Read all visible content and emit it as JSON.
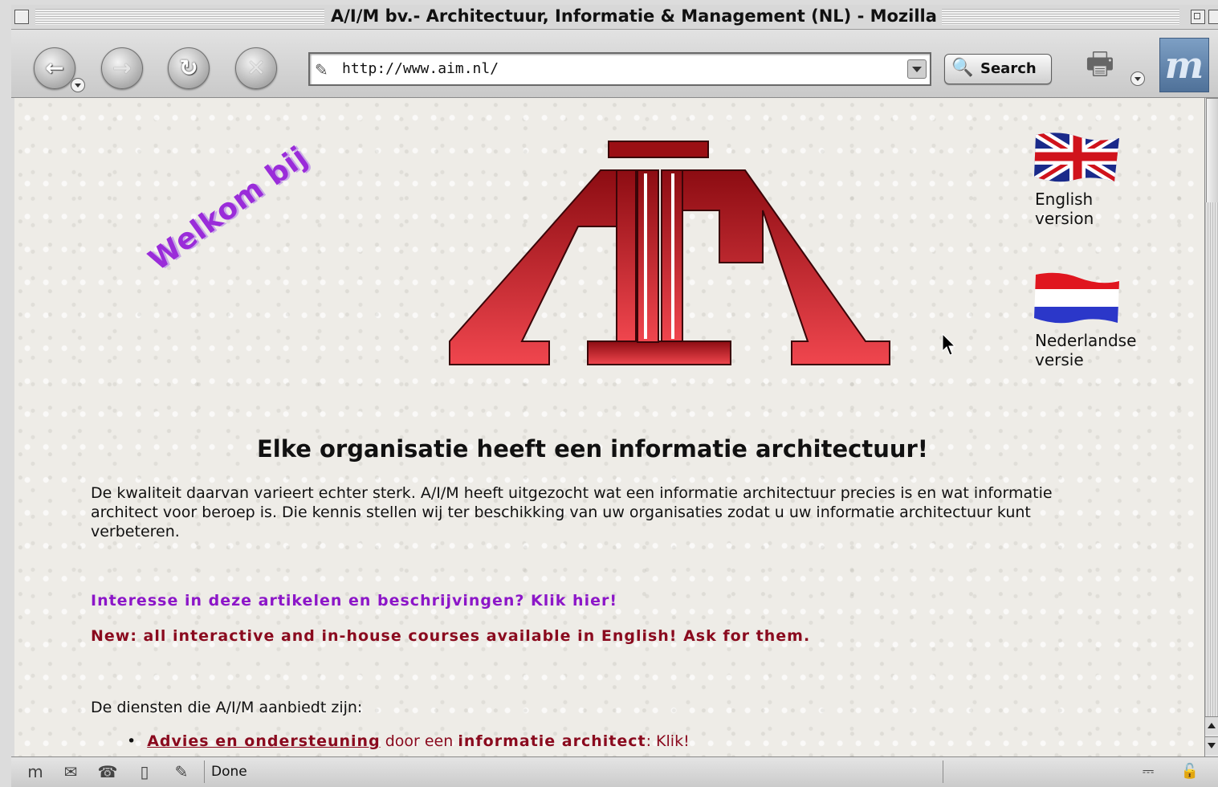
{
  "window": {
    "title": "A/I/M bv.- Architectuur, Informatie & Management (NL) - Mozilla"
  },
  "toolbar": {
    "back_icon": "←",
    "forward_icon": "→",
    "reload_icon": "↻",
    "stop_icon": "✕",
    "url": "http://www.aim.nl/",
    "search_label": "Search",
    "search_icon": "🔍",
    "print_icon": "🖶",
    "logo_letter": "m"
  },
  "page": {
    "welcome": "Welkom bij",
    "logo_text": "AIM",
    "english_label_1": "English",
    "english_label_2": "version",
    "dutch_label_1": "Nederlandse",
    "dutch_label_2": "versie",
    "heading": "Elke organisatie heeft een informatie architectuur!",
    "intro": "De kwaliteit daarvan varieert echter sterk. A/I/M heeft uitgezocht wat een informatie architectuur precies is en wat informatie architect voor beroep is. Die kennis stellen wij ter beschikking van uw organisaties zodat u uw informatie architectuur kunt verbeteren.",
    "articles_link": "Interesse in deze artikelen en beschrijvingen? Klik hier!",
    "news": "New: all interactive and in-house courses available in English! Ask for them.",
    "services_intro": "De diensten die A/I/M aanbiedt zijn:",
    "service_item": {
      "bullet": "•",
      "link": "Advies en ondersteuning",
      "middle": " door een ",
      "bold": "informatie architect",
      "end": ": Klik!"
    }
  },
  "statusbar": {
    "text": "Done",
    "icons": [
      "m",
      "✉",
      "☎",
      "▯",
      "✎"
    ]
  },
  "colors": {
    "logo_red": "#c3161f",
    "welcome_purple": "#9a2cd9",
    "link_purple": "#8c16c8",
    "news_red": "#8a0a1e"
  }
}
